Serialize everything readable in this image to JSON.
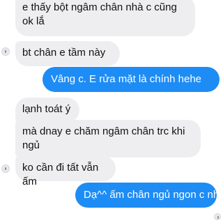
{
  "colors": {
    "incoming_bubble": "#eeeef0",
    "outgoing_bubble": "#1e8cf5",
    "incoming_text": "#111111",
    "outgoing_text": "#ffffff"
  },
  "messages": [
    {
      "sender": "other",
      "text": "e thấy bột ngâm chân nhà c cũng\nok lắ"
    },
    {
      "sender": "other",
      "text": "bt chân e tầm này"
    },
    {
      "sender": "me",
      "text": "Vâng c. E rửa mặt là chính hehe"
    },
    {
      "sender": "other",
      "text": "lạnh toát ý"
    },
    {
      "sender": "other",
      "text": "mà dnay e chăm ngâm chân trc khi\nngủ"
    },
    {
      "sender": "other",
      "text": "ko cần đi tất vẫn ấm"
    },
    {
      "sender": "me",
      "text": "Dạ^^ ấm chân ngủ ngon c nhờ"
    }
  ]
}
